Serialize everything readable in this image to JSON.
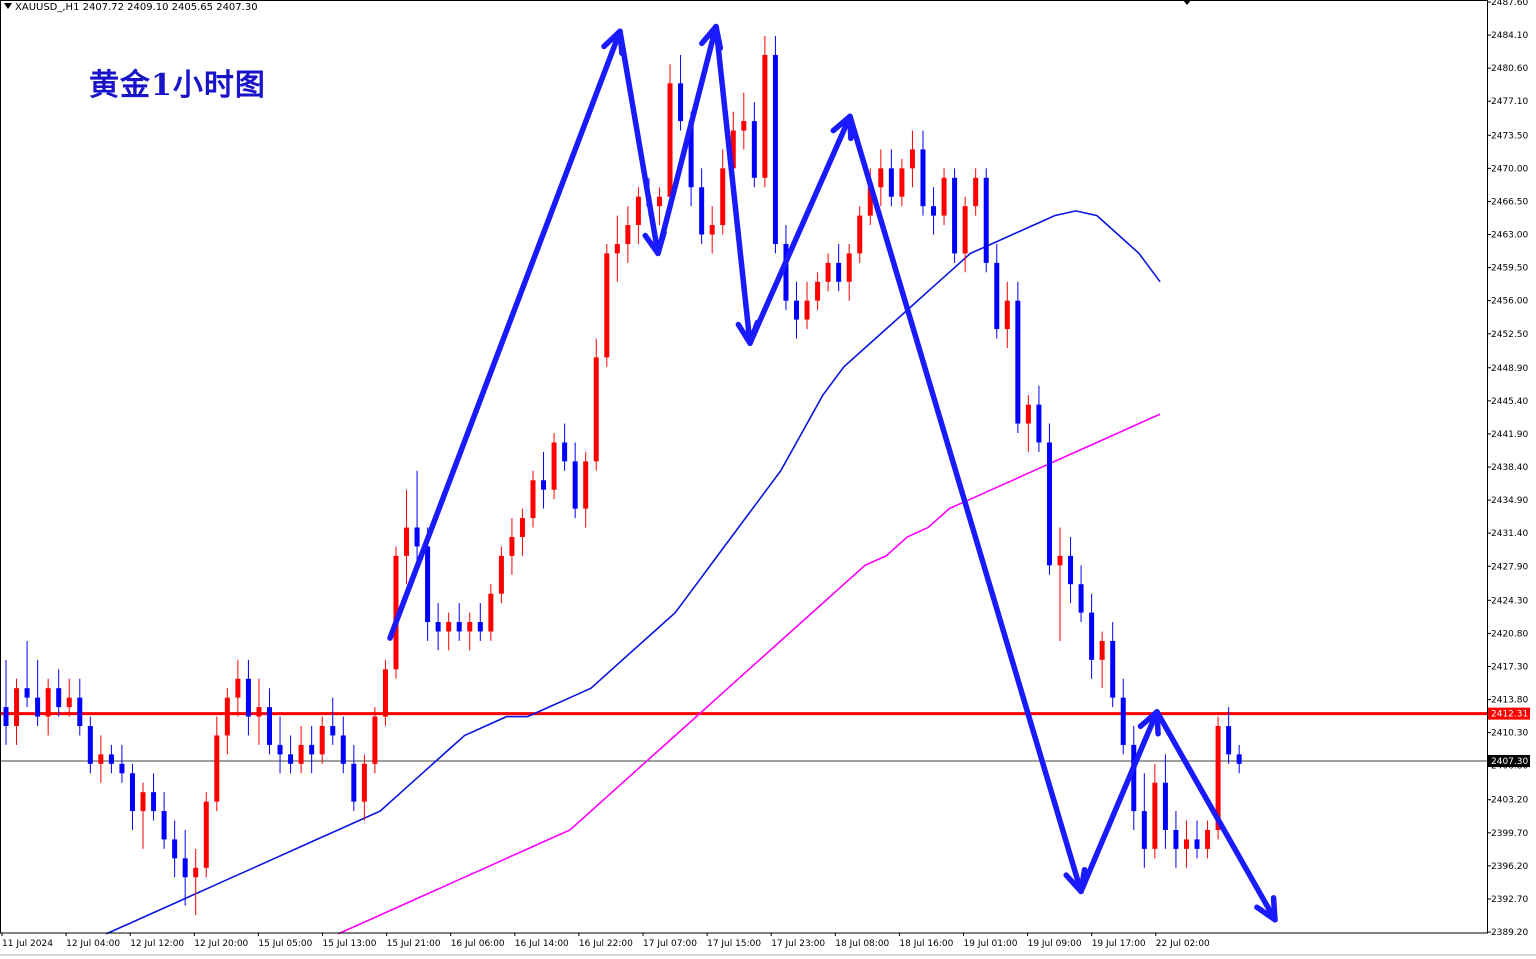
{
  "header": {
    "symbol_info": "XAUUSD_,H1  2407.72 2409.10 2405.65 2407.30"
  },
  "annotation": {
    "title": "黄金1小时图"
  },
  "colors": {
    "bull": "#ff0000",
    "bear": "#0000ff",
    "ma_fast": "#0a14e0",
    "ma_slow": "#ff00ff",
    "arrows": "#1a1aff",
    "resistance": "#ff0000"
  },
  "chart_data": {
    "type": "candlestick",
    "symbol": "XAUUSD_",
    "timeframe": "H1",
    "ohlc_last": {
      "open": 2407.72,
      "high": 2409.1,
      "low": 2405.65,
      "close": 2407.3
    },
    "ylim": [
      2389.1,
      2487.6
    ],
    "y_ticks": [
      "2487.60",
      "2484.10",
      "2480.60",
      "2477.10",
      "2473.50",
      "2470.00",
      "2466.50",
      "2463.00",
      "2459.50",
      "2456.00",
      "2452.50",
      "2448.90",
      "2445.40",
      "2441.90",
      "2438.40",
      "2434.90",
      "2431.40",
      "2427.90",
      "2424.30",
      "2420.80",
      "2417.30",
      "2413.80",
      "2410.30",
      "2406.80",
      "2403.20",
      "2399.70",
      "2396.20",
      "2392.70",
      "2389.20"
    ],
    "x_ticks": [
      "11 Jul 2024",
      "12 Jul 04:00",
      "12 Jul 12:00",
      "12 Jul 20:00",
      "15 Jul 05:00",
      "15 Jul 13:00",
      "15 Jul 21:00",
      "16 Jul 06:00",
      "16 Jul 14:00",
      "16 Jul 22:00",
      "17 Jul 07:00",
      "17 Jul 15:00",
      "17 Jul 23:00",
      "18 Jul 08:00",
      "18 Jul 16:00",
      "19 Jul 01:00",
      "19 Jul 09:00",
      "19 Jul 17:00",
      "22 Jul 02:00"
    ],
    "price_tags": [
      {
        "label": "2412.31",
        "value": 2412.31,
        "style": "resistance"
      },
      {
        "label": "2407.30",
        "value": 2407.3,
        "style": "current"
      }
    ],
    "candles": [
      [
        2413,
        2418,
        2409,
        2411
      ],
      [
        2411,
        2416,
        2409,
        2415
      ],
      [
        2415,
        2420,
        2413,
        2414
      ],
      [
        2414,
        2418,
        2411,
        2412
      ],
      [
        2412,
        2416,
        2410,
        2415
      ],
      [
        2415,
        2417,
        2412,
        2413
      ],
      [
        2413,
        2416,
        2412,
        2414
      ],
      [
        2414,
        2416,
        2410,
        2411
      ],
      [
        2411,
        2412,
        2406,
        2407
      ],
      [
        2407,
        2410,
        2405,
        2408
      ],
      [
        2408,
        2409,
        2406,
        2407
      ],
      [
        2407,
        2409,
        2405,
        2406
      ],
      [
        2406,
        2407,
        2400,
        2402
      ],
      [
        2402,
        2405,
        2398,
        2404
      ],
      [
        2404,
        2406,
        2401,
        2402
      ],
      [
        2402,
        2404,
        2398,
        2399
      ],
      [
        2399,
        2401,
        2395,
        2397
      ],
      [
        2397,
        2400,
        2392,
        2395
      ],
      [
        2395,
        2398,
        2391,
        2396
      ],
      [
        2396,
        2404,
        2395,
        2403
      ],
      [
        2403,
        2412,
        2402,
        2410
      ],
      [
        2410,
        2415,
        2408,
        2414
      ],
      [
        2414,
        2418,
        2412,
        2416
      ],
      [
        2416,
        2418,
        2410,
        2412
      ],
      [
        2412,
        2416,
        2409,
        2413
      ],
      [
        2413,
        2415,
        2408,
        2409
      ],
      [
        2409,
        2412,
        2406,
        2408
      ],
      [
        2408,
        2410,
        2406,
        2407
      ],
      [
        2407,
        2411,
        2406,
        2409
      ],
      [
        2409,
        2411,
        2406,
        2408
      ],
      [
        2408,
        2412,
        2407,
        2411
      ],
      [
        2411,
        2414,
        2409,
        2410
      ],
      [
        2410,
        2412,
        2406,
        2407
      ],
      [
        2407,
        2409,
        2402,
        2403
      ],
      [
        2403,
        2408,
        2401,
        2407
      ],
      [
        2407,
        2413,
        2406,
        2412
      ],
      [
        2412,
        2418,
        2411,
        2417
      ],
      [
        2417,
        2430,
        2416,
        2429
      ],
      [
        2429,
        2436,
        2426,
        2432
      ],
      [
        2432,
        2438,
        2428,
        2430
      ],
      [
        2430,
        2432,
        2420,
        2422
      ],
      [
        2422,
        2424,
        2419,
        2421
      ],
      [
        2421,
        2423,
        2419,
        2422
      ],
      [
        2422,
        2424,
        2420,
        2421
      ],
      [
        2421,
        2423,
        2419,
        2422
      ],
      [
        2422,
        2424,
        2420,
        2421
      ],
      [
        2421,
        2426,
        2420,
        2425
      ],
      [
        2425,
        2430,
        2424,
        2429
      ],
      [
        2429,
        2433,
        2427,
        2431
      ],
      [
        2431,
        2434,
        2429,
        2433
      ],
      [
        2433,
        2438,
        2432,
        2437
      ],
      [
        2437,
        2440,
        2434,
        2436
      ],
      [
        2436,
        2442,
        2435,
        2441
      ],
      [
        2441,
        2443,
        2438,
        2439
      ],
      [
        2439,
        2441,
        2433,
        2434
      ],
      [
        2434,
        2440,
        2432,
        2439
      ],
      [
        2439,
        2452,
        2438,
        2450
      ],
      [
        2450,
        2462,
        2449,
        2461
      ],
      [
        2461,
        2465,
        2458,
        2462
      ],
      [
        2462,
        2466,
        2460,
        2464
      ],
      [
        2464,
        2468,
        2462,
        2467
      ],
      [
        2467,
        2469,
        2465,
        2466
      ],
      [
        2466,
        2468,
        2464,
        2467
      ],
      [
        2467,
        2481,
        2466,
        2479
      ],
      [
        2479,
        2482,
        2474,
        2475
      ],
      [
        2475,
        2476,
        2466,
        2468
      ],
      [
        2468,
        2470,
        2462,
        2463
      ],
      [
        2463,
        2466,
        2461,
        2464
      ],
      [
        2464,
        2472,
        2463,
        2470
      ],
      [
        2470,
        2476,
        2468,
        2474
      ],
      [
        2474,
        2478,
        2472,
        2475
      ],
      [
        2475,
        2477,
        2468,
        2469
      ],
      [
        2469,
        2484,
        2468,
        2482
      ],
      [
        2482,
        2484,
        2461,
        2462
      ],
      [
        2462,
        2464,
        2455,
        2456
      ],
      [
        2456,
        2458,
        2452,
        2454
      ],
      [
        2454,
        2458,
        2453,
        2456
      ],
      [
        2456,
        2459,
        2455,
        2458
      ],
      [
        2458,
        2461,
        2457,
        2460
      ],
      [
        2460,
        2462,
        2457,
        2458
      ],
      [
        2458,
        2462,
        2456,
        2461
      ],
      [
        2461,
        2466,
        2460,
        2465
      ],
      [
        2465,
        2470,
        2464,
        2468
      ],
      [
        2468,
        2472,
        2466,
        2470
      ],
      [
        2470,
        2472,
        2466,
        2467
      ],
      [
        2467,
        2471,
        2466,
        2470
      ],
      [
        2470,
        2474,
        2468,
        2472
      ],
      [
        2472,
        2474,
        2465,
        2466
      ],
      [
        2466,
        2468,
        2463,
        2465
      ],
      [
        2465,
        2470,
        2464,
        2469
      ],
      [
        2469,
        2470,
        2460,
        2461
      ],
      [
        2461,
        2467,
        2459,
        2466
      ],
      [
        2466,
        2470,
        2465,
        2469
      ],
      [
        2469,
        2470,
        2459,
        2460
      ],
      [
        2460,
        2462,
        2452,
        2453
      ],
      [
        2453,
        2458,
        2451,
        2456
      ],
      [
        2456,
        2458,
        2442,
        2443
      ],
      [
        2443,
        2446,
        2440,
        2445
      ],
      [
        2445,
        2447,
        2440,
        2441
      ],
      [
        2441,
        2443,
        2427,
        2428
      ],
      [
        2428,
        2432,
        2420,
        2429
      ],
      [
        2429,
        2431,
        2424,
        2426
      ],
      [
        2426,
        2428,
        2422,
        2423
      ],
      [
        2423,
        2425,
        2416,
        2418
      ],
      [
        2418,
        2421,
        2415,
        2420
      ],
      [
        2420,
        2422,
        2413,
        2414
      ],
      [
        2414,
        2416,
        2408,
        2409
      ],
      [
        2409,
        2411,
        2400,
        2402
      ],
      [
        2402,
        2406,
        2396,
        2398
      ],
      [
        2398,
        2407,
        2397,
        2405
      ],
      [
        2405,
        2408,
        2398,
        2400
      ],
      [
        2400,
        2402,
        2396,
        2398
      ],
      [
        2398,
        2401,
        2396,
        2399
      ],
      [
        2399,
        2401,
        2397,
        2398
      ],
      [
        2398,
        2401,
        2397,
        2400
      ],
      [
        2400,
        2412,
        2399,
        2411
      ],
      [
        2411,
        2413,
        2407,
        2408
      ],
      [
        2408,
        2409,
        2406,
        2407
      ]
    ],
    "series": [
      {
        "name": "",
        "type": "ma",
        "values": [
          2389,
          2390,
          2391,
          2392,
          2393,
          2394,
          2395,
          2396,
          2397,
          2398,
          2399,
          2400,
          2401,
          2402,
          2404,
          2406,
          2408,
          2410,
          2411,
          2412,
          2412,
          2413,
          2414,
          2415,
          2417,
          2419,
          2421,
          2423,
          2426,
          2429,
          2432,
          2435,
          2438,
          2442,
          2446,
          2449,
          2451,
          2453,
          2455,
          2457,
          2459,
          2461,
          2462,
          2463,
          2464,
          2465,
          2465.5,
          2465,
          2463,
          2461,
          2458,
          2455,
          2451,
          2447,
          2443,
          2440,
          2437,
          2435
        ]
      },
      {
        "name": "",
        "type": "ma",
        "values": [
          2389,
          2390,
          2391,
          2392,
          2393,
          2394,
          2395,
          2396,
          2397,
          2398,
          2399,
          2400,
          2402,
          2404,
          2406,
          2408,
          2410,
          2412,
          2414,
          2416,
          2418,
          2420,
          2422,
          2424,
          2426,
          2428,
          2429,
          2431,
          2432,
          2434,
          2435,
          2436,
          2437,
          2438,
          2439,
          2440,
          2441,
          2442,
          2443,
          2444,
          2444.5,
          2445,
          2445.3,
          2445.5,
          2445.7,
          2445.8,
          2445.8,
          2445.6,
          2445.3,
          2445,
          2444.5,
          2444
        ]
      }
    ],
    "horizontal_lines": [
      {
        "value": 2412.31,
        "style": "resistance"
      },
      {
        "value": 2407.3,
        "style": "current"
      }
    ],
    "arrows": [
      [
        [
          1,
          2420.3
        ],
        [
          10,
          2484.5
        ]
      ],
      [
        [
          10,
          2484.5
        ],
        [
          14,
          2461
        ]
      ],
      [
        [
          14,
          2461
        ],
        [
          20,
          2485
        ]
      ],
      [
        [
          20,
          2485
        ],
        [
          24,
          2451.5
        ]
      ],
      [
        [
          24,
          2451.5
        ],
        [
          31,
          2475.5
        ]
      ],
      [
        [
          31,
          2475.5
        ],
        [
          50,
          2393.5
        ]
      ],
      [
        [
          50,
          2393.5
        ],
        [
          56,
          2412.5
        ]
      ],
      [
        [
          56,
          2412.5
        ],
        [
          66,
          2390.5
        ]
      ]
    ]
  }
}
